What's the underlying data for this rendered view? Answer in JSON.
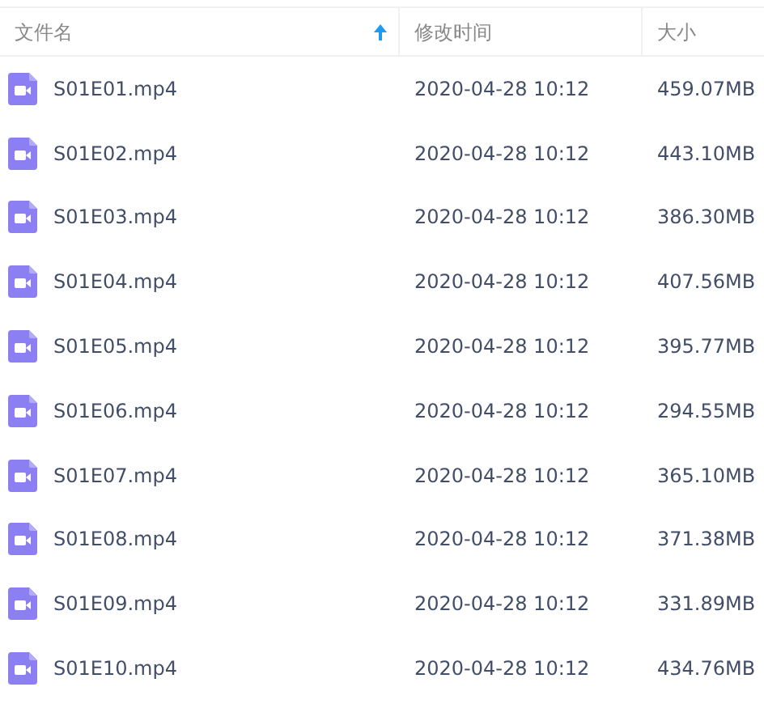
{
  "columns": [
    {
      "label": "文件名",
      "sorted": true
    },
    {
      "label": "修改时间",
      "sorted": false
    },
    {
      "label": "大小",
      "sorted": false
    }
  ],
  "rows": [
    {
      "name": "S01E01.mp4",
      "modified": "2020-04-28 10:12",
      "size": "459.07MB"
    },
    {
      "name": "S01E02.mp4",
      "modified": "2020-04-28 10:12",
      "size": "443.10MB"
    },
    {
      "name": "S01E03.mp4",
      "modified": "2020-04-28 10:12",
      "size": "386.30MB"
    },
    {
      "name": "S01E04.mp4",
      "modified": "2020-04-28 10:12",
      "size": "407.56MB"
    },
    {
      "name": "S01E05.mp4",
      "modified": "2020-04-28 10:12",
      "size": "395.77MB"
    },
    {
      "name": "S01E06.mp4",
      "modified": "2020-04-28 10:12",
      "size": "294.55MB"
    },
    {
      "name": "S01E07.mp4",
      "modified": "2020-04-28 10:12",
      "size": "365.10MB"
    },
    {
      "name": "S01E08.mp4",
      "modified": "2020-04-28 10:12",
      "size": "371.38MB"
    },
    {
      "name": "S01E09.mp4",
      "modified": "2020-04-28 10:12",
      "size": "331.89MB"
    },
    {
      "name": "S01E10.mp4",
      "modified": "2020-04-28 10:12",
      "size": "434.76MB"
    }
  ]
}
